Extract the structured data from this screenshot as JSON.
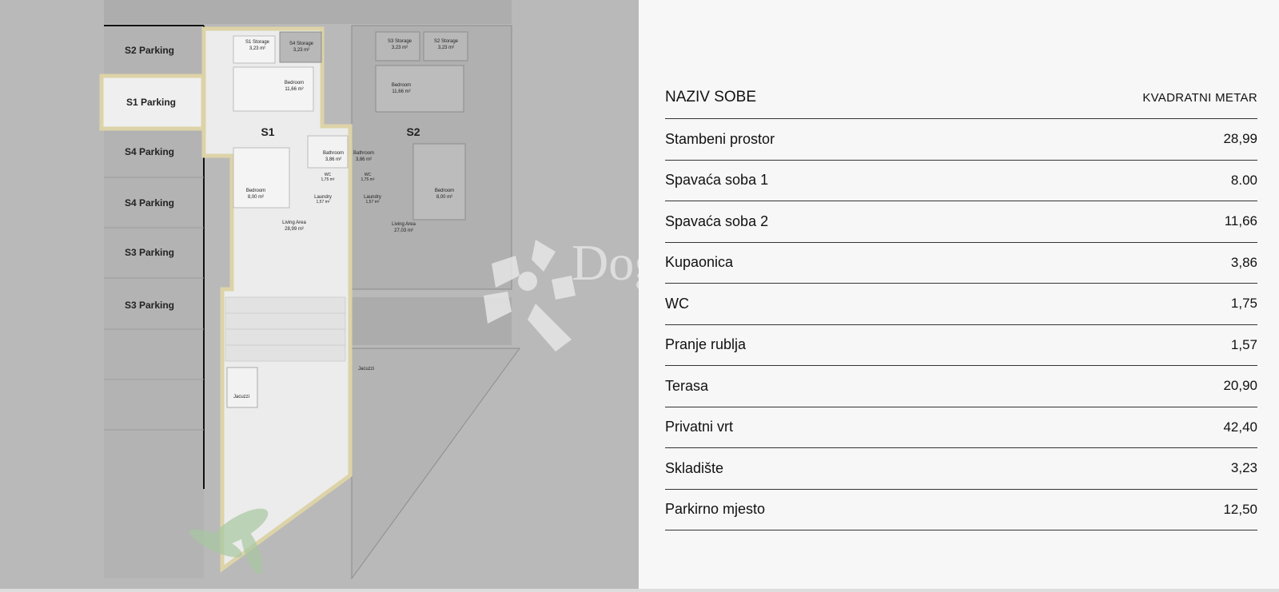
{
  "floorplan": {
    "parking_labels": [
      "S2 Parking",
      "S1 Parking",
      "S4 Parking",
      "S4 Parking",
      "S3 Parking",
      "S3 Parking"
    ],
    "unit_labels": [
      "S1",
      "S2"
    ],
    "storage": [
      {
        "name": "S1 Storage",
        "area": "3,23 m²"
      },
      {
        "name": "S4 Storage",
        "area": "3,23 m²"
      },
      {
        "name": "S3 Storage",
        "area": "3,23 m²"
      },
      {
        "name": "S2 Storage",
        "area": "3,23 m²"
      }
    ],
    "rooms_s1": [
      {
        "name": "Bedroom",
        "area": "11,66 m²"
      },
      {
        "name": "Bathroom",
        "area": "3,86 m²"
      },
      {
        "name": "WC",
        "area": "1,75 m²"
      },
      {
        "name": "Laundry",
        "area": "1,57 m²"
      },
      {
        "name": "Bedroom",
        "area": "8,00 m²"
      },
      {
        "name": "Living Area",
        "area": "28,99 m²"
      }
    ],
    "rooms_s2": [
      {
        "name": "Bedroom",
        "area": "11,66 m²"
      },
      {
        "name": "Bathroom",
        "area": "3,86 m²"
      },
      {
        "name": "WC",
        "area": "1,75 m²"
      },
      {
        "name": "Laundry",
        "area": "1,57 m²"
      },
      {
        "name": "Bedroom",
        "area": "8,00 m²"
      },
      {
        "name": "Living Area",
        "area": "27,03 m²"
      }
    ],
    "jacuzzi_labels": [
      "Jacuzzi",
      "Jacuzzi"
    ],
    "highlight_color": "#efe6c6",
    "outline_color": "#ddd3a8"
  },
  "watermark": {
    "text": "Dogma"
  },
  "table": {
    "header_left": "NAZIV SOBE",
    "header_right": "KVADRATNI METAR",
    "rows": [
      {
        "name": "Stambeni prostor",
        "value": "28,99"
      },
      {
        "name": "Spavaća soba 1",
        "value": "8.00"
      },
      {
        "name": "Spavaća soba 2",
        "value": "11,66"
      },
      {
        "name": "Kupaonica",
        "value": "3,86"
      },
      {
        "name": "WC",
        "value": "1,75"
      },
      {
        "name": "Pranje rublja",
        "value": "1,57"
      },
      {
        "name": "Terasa",
        "value": "20,90"
      },
      {
        "name": "Privatni vrt",
        "value": "42,40"
      },
      {
        "name": "Skladište",
        "value": "3,23"
      },
      {
        "name": "Parkirno mjesto",
        "value": "12,50"
      }
    ]
  }
}
